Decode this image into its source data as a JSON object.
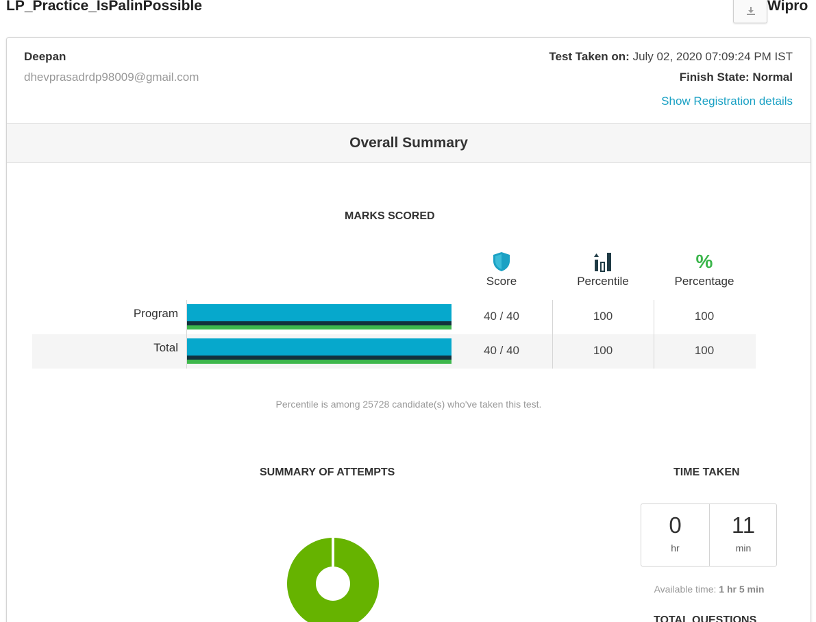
{
  "header": {
    "title": "LP_Practice_IsPalinPossible",
    "org_name": "Wipro",
    "download_icon": "download-icon"
  },
  "candidate": {
    "name": "Deepan",
    "email": "dhevprasadrdp98009@gmail.com",
    "test_taken_label": "Test Taken on:",
    "test_taken_value": "July 02, 2020 07:09:24 PM IST",
    "finish_state": "Finish State: Normal",
    "registration_link": "Show Registration details"
  },
  "overall_summary": {
    "title": "Overall Summary"
  },
  "marks_scored": {
    "heading": "MARKS SCORED",
    "columns": [
      {
        "label": "Score",
        "icon": "shield-icon",
        "color": "#1ba1c4"
      },
      {
        "label": "Percentile",
        "icon": "bar-chart-icon",
        "color": "#1f3b45"
      },
      {
        "label": "Percentage",
        "icon": "percent-icon",
        "color": "#3ab54a"
      }
    ],
    "rows": [
      {
        "label": "Program",
        "score": "40 / 40",
        "percentile": "100",
        "percentage": "100",
        "fill": 1.0
      },
      {
        "label": "Total",
        "score": "40 / 40",
        "percentile": "100",
        "percentage": "100",
        "fill": 1.0
      }
    ],
    "colors": {
      "bar": "#06a8cc",
      "bar_dark": "#12313c",
      "bar_green": "#3db74c"
    },
    "note": "Percentile is among 25728 candidate(s) who've taken this test."
  },
  "attempts": {
    "heading": "SUMMARY OF ATTEMPTS",
    "color": "#66b300"
  },
  "time_taken": {
    "heading": "TIME TAKEN",
    "hours": "0",
    "hours_unit": "hr",
    "minutes": "11",
    "minutes_unit": "min",
    "available_label": "Available time:",
    "available_value": "1 hr 5 min"
  },
  "total_questions": {
    "heading": "TOTAL QUESTIONS"
  }
}
